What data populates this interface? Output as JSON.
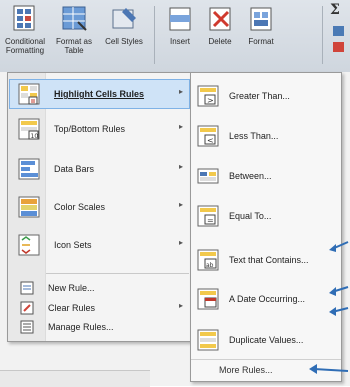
{
  "ribbon": {
    "conditional_formatting": "Conditional Formatting",
    "format_as_table": "Format as Table",
    "cell_styles": "Cell Styles",
    "insert": "Insert",
    "delete": "Delete",
    "format": "Format",
    "sigma": "Σ"
  },
  "main_menu": {
    "items": [
      {
        "label": "Highlight Cells Rules",
        "icon": "highlight-cells-icon",
        "submenu": true,
        "active": true
      },
      {
        "label": "Top/Bottom Rules",
        "icon": "top-bottom-icon",
        "submenu": true
      },
      {
        "label": "Data Bars",
        "icon": "data-bars-icon",
        "submenu": true
      },
      {
        "label": "Color Scales",
        "icon": "color-scales-icon",
        "submenu": true
      },
      {
        "label": "Icon Sets",
        "icon": "icon-sets-icon",
        "submenu": true
      },
      {
        "label": "New Rule...",
        "icon": "new-rule-icon"
      },
      {
        "label": "Clear Rules",
        "icon": "clear-rules-icon",
        "submenu": true
      },
      {
        "label": "Manage Rules...",
        "icon": "manage-rules-icon"
      }
    ],
    "submenu_arrow": "▸"
  },
  "sub_menu": {
    "items": [
      {
        "label": "Greater Than...",
        "icon": "greater-than-icon"
      },
      {
        "label": "Less Than...",
        "icon": "less-than-icon"
      },
      {
        "label": "Between...",
        "icon": "between-icon"
      },
      {
        "label": "Equal To...",
        "icon": "equal-to-icon"
      },
      {
        "label": "Text that Contains...",
        "icon": "text-contains-icon"
      },
      {
        "label": "A Date Occurring...",
        "icon": "date-occurring-icon"
      },
      {
        "label": "Duplicate Values...",
        "icon": "duplicate-values-icon"
      }
    ],
    "more_rules": "More Rules..."
  },
  "colors": {
    "accent_arrow": "#2f6db5",
    "menu_highlight": "#cfe3f7"
  }
}
